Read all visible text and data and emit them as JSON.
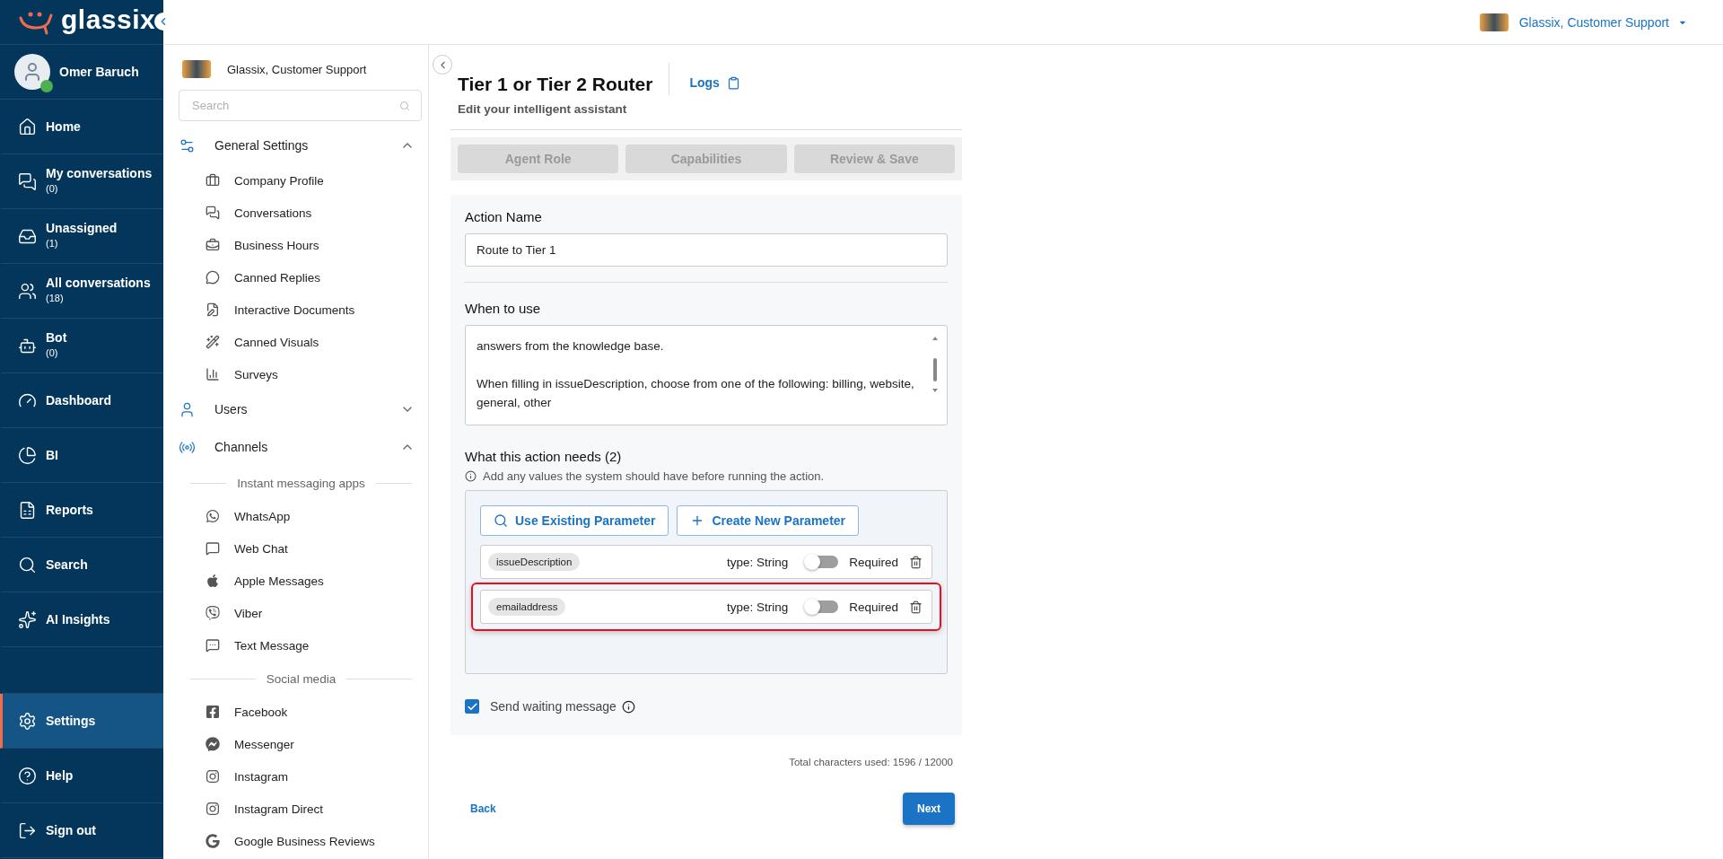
{
  "nav": {
    "logo": "glassix",
    "user": {
      "name": "Omer Baruch",
      "online": true
    },
    "items": [
      {
        "label": "Home",
        "selected": false
      },
      {
        "label": "My conversations",
        "count": "(0)",
        "selected": false
      },
      {
        "label": "Unassigned",
        "count": "(1)",
        "selected": false
      },
      {
        "label": "All conversations",
        "count": "(18)",
        "selected": false
      },
      {
        "label": "Bot",
        "count": "(0)",
        "selected": false
      },
      {
        "label": "Dashboard",
        "selected": false
      },
      {
        "label": "BI",
        "selected": false
      },
      {
        "label": "Reports",
        "selected": false
      },
      {
        "label": "Search",
        "selected": false
      },
      {
        "label": "AI Insights",
        "selected": false
      }
    ],
    "bottom_items": [
      {
        "label": "Settings",
        "selected": true
      },
      {
        "label": "Help",
        "selected": false
      },
      {
        "label": "Sign out",
        "selected": false
      }
    ]
  },
  "header": {
    "account": "Glassix, Customer Support"
  },
  "sidebar": {
    "account": "Glassix, Customer Support",
    "search": {
      "placeholder": "Search"
    },
    "sections": [
      {
        "title": "General Settings",
        "expanded": true,
        "children": [
          {
            "kind": "item",
            "label": "Company Profile"
          },
          {
            "kind": "item",
            "label": "Conversations"
          },
          {
            "kind": "item",
            "label": "Business Hours"
          },
          {
            "kind": "item",
            "label": "Canned Replies"
          },
          {
            "kind": "item",
            "label": "Interactive Documents"
          },
          {
            "kind": "item",
            "label": "Canned Visuals"
          },
          {
            "kind": "item",
            "label": "Surveys"
          }
        ]
      },
      {
        "title": "Users",
        "expanded": false
      },
      {
        "title": "Channels",
        "expanded": true,
        "children": [
          {
            "kind": "heading",
            "label": "Instant messaging apps"
          },
          {
            "kind": "item",
            "label": "WhatsApp"
          },
          {
            "kind": "item",
            "label": "Web Chat"
          },
          {
            "kind": "item",
            "label": "Apple Messages"
          },
          {
            "kind": "item",
            "label": "Viber"
          },
          {
            "kind": "item",
            "label": "Text Message"
          },
          {
            "kind": "heading",
            "label": "Social media"
          },
          {
            "kind": "item",
            "label": "Facebook"
          },
          {
            "kind": "item",
            "label": "Messenger"
          },
          {
            "kind": "item",
            "label": "Instagram"
          },
          {
            "kind": "item",
            "label": "Instagram Direct"
          },
          {
            "kind": "item",
            "label": "Google Business Reviews"
          }
        ]
      }
    ]
  },
  "page": {
    "title": "Tier 1 or Tier 2 Router",
    "logs": "Logs",
    "subtitle": "Edit your intelligent assistant",
    "steps": [
      {
        "label": "Agent Role",
        "disabled": true
      },
      {
        "label": "Capabilities",
        "disabled": true
      },
      {
        "label": "Review & Save",
        "disabled": true
      }
    ],
    "form": {
      "action_name": {
        "label": "Action Name",
        "value": "Route to Tier 1"
      },
      "when_to_use": {
        "label": "When to use",
        "value": "answers from the knowledge base.\n\nWhen filling in issueDescription, choose from one of the following: billing, website, general, other"
      },
      "needs": {
        "title": "What this action needs (2)",
        "hint": "Add any values the system should have before running the action.",
        "buttons": [
          "Use Existing Parameter",
          "Create New Parameter"
        ],
        "parameters": [
          {
            "name": "issueDescription",
            "type": "type: String",
            "required": false,
            "required_label": "Required",
            "highlighted": false
          },
          {
            "name": "emailaddress",
            "type": "type: String",
            "required": false,
            "required_label": "Required",
            "highlighted": true
          }
        ]
      },
      "waiting_message": {
        "label": "Send waiting message",
        "checked": true
      }
    },
    "total_characters": "Total characters used: 1596 / 12000",
    "back": "Back",
    "next": "Next"
  }
}
